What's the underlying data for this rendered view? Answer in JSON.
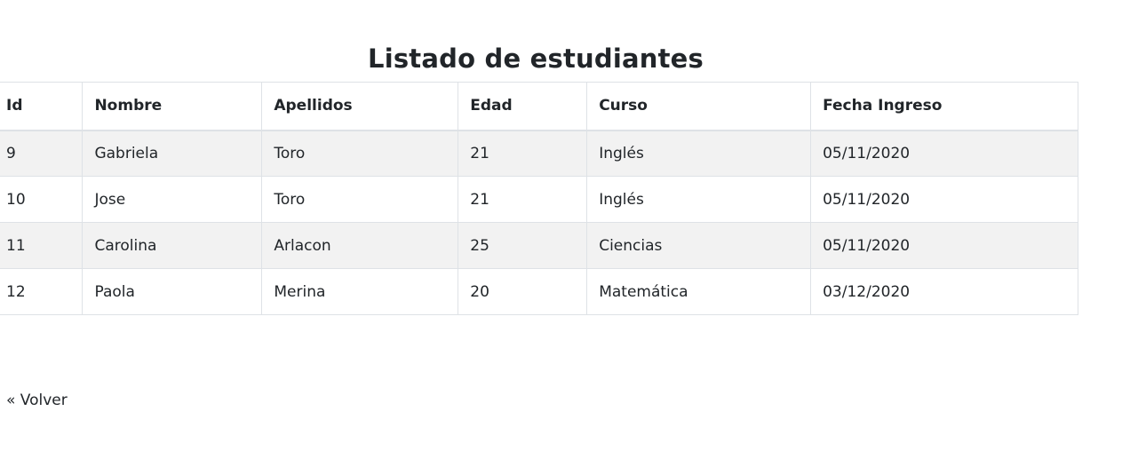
{
  "page_title": "Listado de estudiantes",
  "table": {
    "headers": [
      "Id",
      "Nombre",
      "Apellidos",
      "Edad",
      "Curso",
      "Fecha Ingreso"
    ],
    "rows": [
      [
        "9",
        "Gabriela",
        "Toro",
        "21",
        "Inglés",
        "05/11/2020"
      ],
      [
        "10",
        "Jose",
        "Toro",
        "21",
        "Inglés",
        "05/11/2020"
      ],
      [
        "11",
        "Carolina",
        "Arlacon",
        "25",
        "Ciencias",
        "05/11/2020"
      ],
      [
        "12",
        "Paola",
        "Merina",
        "20",
        "Matemática",
        "03/12/2020"
      ]
    ]
  },
  "back_link": "« Volver",
  "colors": {
    "border": "#dee2e6",
    "stripe": "#f2f2f2",
    "text": "#212529"
  }
}
